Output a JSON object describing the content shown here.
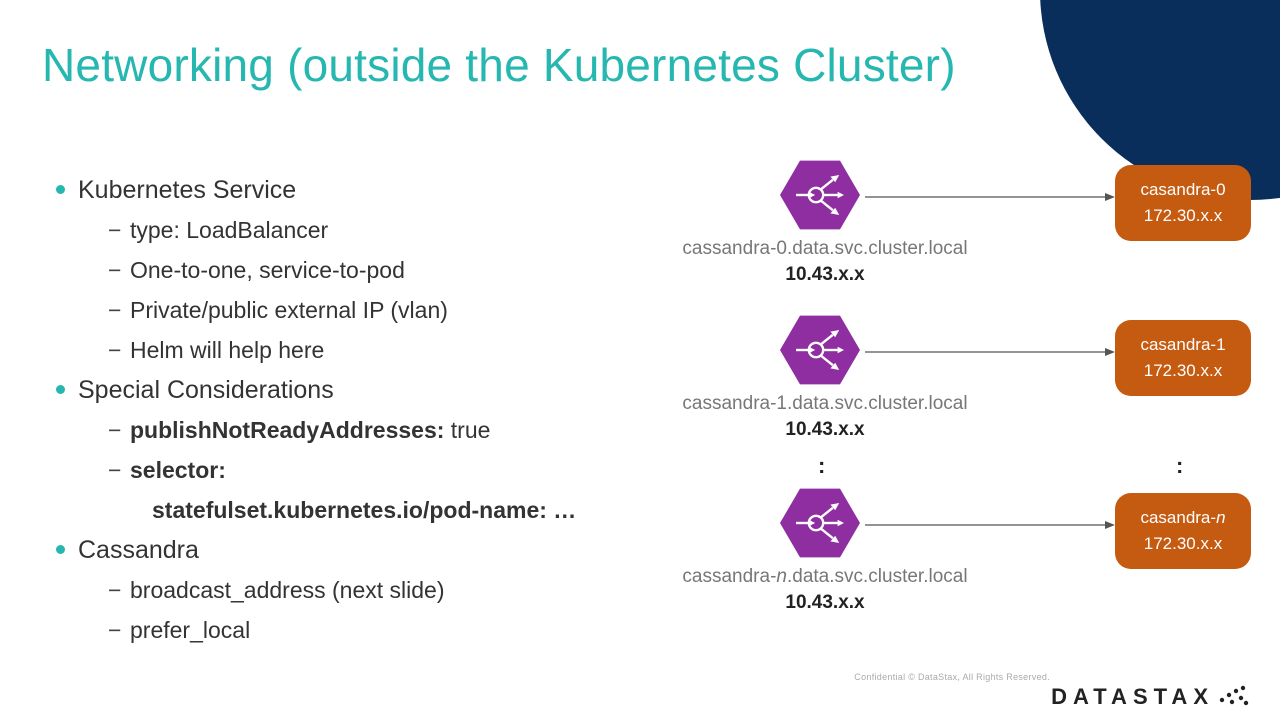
{
  "title": "Networking (outside the Kubernetes Cluster)",
  "bullets": {
    "b1": "Kubernetes Service",
    "b1_1": "type:  LoadBalancer",
    "b1_2": "One-to-one, service-to-pod",
    "b1_3": "Private/public external IP (vlan)",
    "b1_4": "Helm will help here",
    "b2": "Special Considerations",
    "b2_1_label": "publishNotReadyAddresses:",
    "b2_1_value": " true",
    "b2_2_label": "selector:",
    "b2_2_sub": "statefulset.kubernetes.io/pod-name: …",
    "b3": "Cassandra",
    "b3_1": "broadcast_address (next slide)",
    "b3_2": "prefer_local"
  },
  "diagram": {
    "rows": [
      {
        "svc": "cassandra-0.data.svc.cluster.local",
        "svc_ip": "10.43.x.x",
        "node": "casandra-0",
        "node_ip": "172.30.x.x"
      },
      {
        "svc": "cassandra-1.data.svc.cluster.local",
        "svc_ip": "10.43.x.x",
        "node": "casandra-1",
        "node_ip": "172.30.x.x"
      },
      {
        "svc_prefix": "cassandra-",
        "svc_em": "n",
        "svc_suffix": ".data.svc.cluster.local",
        "svc_ip": "10.43.x.x",
        "node_prefix": "casandra-",
        "node_em": "n",
        "node_ip": "172.30.x.x"
      }
    ],
    "vdots": ":"
  },
  "footer": {
    "copyright": "Confidential    © DataStax, All Rights Reserved.",
    "logo": "DATASTAX"
  },
  "colors": {
    "accent": "#25b7b0",
    "hex": "#8e2ea0",
    "box": "#c55a11",
    "corner": "#0a2e5c"
  }
}
